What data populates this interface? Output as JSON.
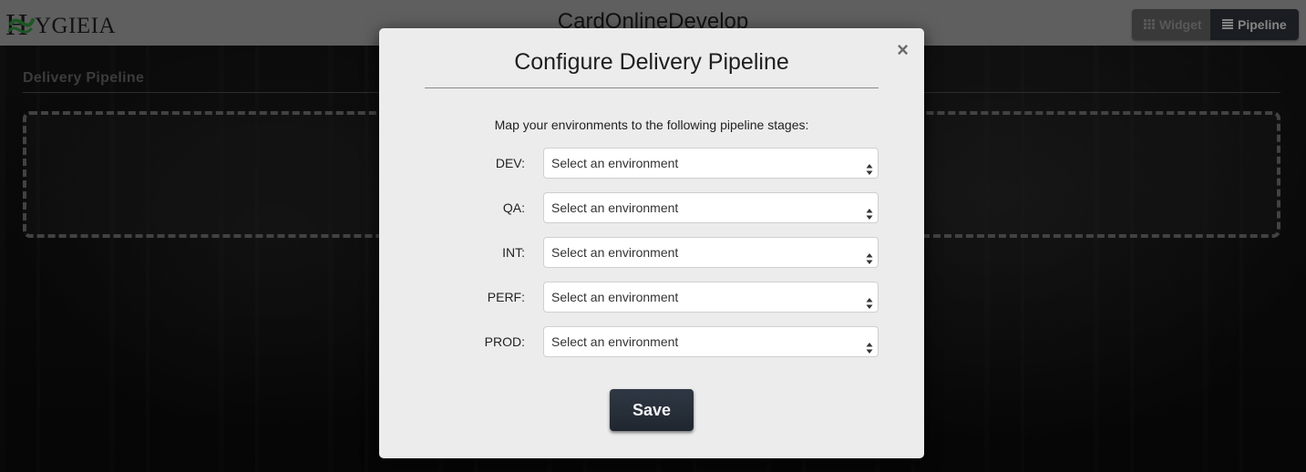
{
  "header": {
    "logo_text": "YGIEIA",
    "logo_full": "HYGIEIA",
    "app_title": "CardOnlineDevelop",
    "view_toggle": {
      "widget_label": "Widget",
      "pipeline_label": "Pipeline",
      "active": "Pipeline"
    }
  },
  "main": {
    "section_title": "Delivery Pipeline"
  },
  "modal": {
    "title": "Configure Delivery Pipeline",
    "close_symbol": "×",
    "instructions": "Map your environments to the following pipeline stages:",
    "stages": [
      {
        "label": "DEV:",
        "value": "Select an environment"
      },
      {
        "label": "QA:",
        "value": "Select an environment"
      },
      {
        "label": "INT:",
        "value": "Select an environment"
      },
      {
        "label": "PERF:",
        "value": "Select an environment"
      },
      {
        "label": "PROD:",
        "value": "Select an environment"
      }
    ],
    "save_label": "Save"
  },
  "colors": {
    "topbar": "#9a9a9a",
    "modal_bg": "#ececec",
    "save_button": "#262d36",
    "logo_accent": "#2e8b3a"
  },
  "icons": {
    "widget": "grid-icon",
    "pipeline": "list-icon",
    "select_arrows": "sort-arrows-icon",
    "close": "close-icon"
  }
}
